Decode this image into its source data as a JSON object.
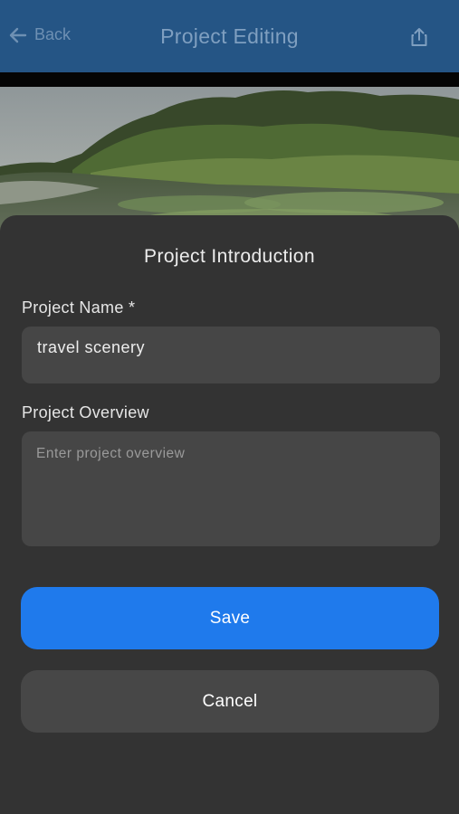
{
  "navbar": {
    "back_label": "Back",
    "title": "Project Editing",
    "back_icon": "arrow-left-icon",
    "share_icon": "share-icon",
    "color": "#255585"
  },
  "sheet": {
    "title": "Project Introduction",
    "name_label": "Project Name *",
    "name_value": "travel scenery",
    "overview_label": "Project Overview",
    "overview_placeholder": "Enter project overview",
    "save_label": "Save",
    "cancel_label": "Cancel",
    "save_color": "#1f7aec"
  }
}
